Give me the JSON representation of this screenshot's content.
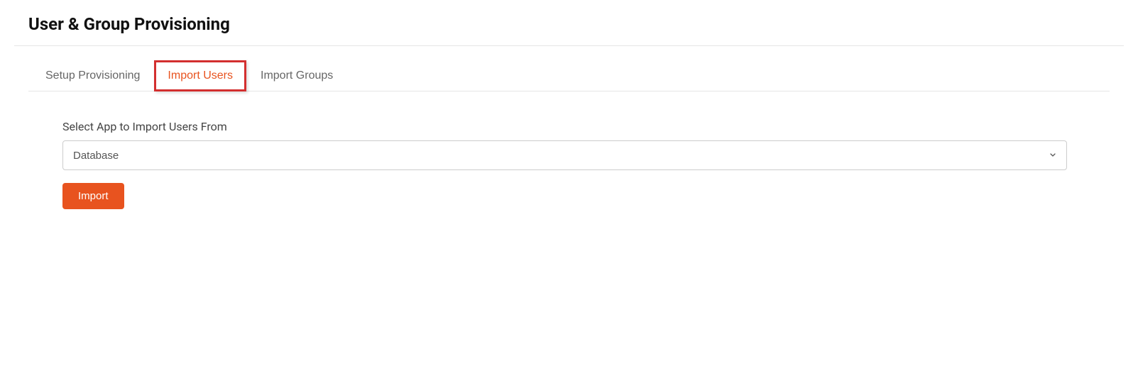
{
  "header": {
    "title": "User & Group Provisioning"
  },
  "tabs": [
    {
      "label": "Setup Provisioning",
      "active": false,
      "highlighted": false
    },
    {
      "label": "Import Users",
      "active": true,
      "highlighted": true
    },
    {
      "label": "Import Groups",
      "active": false,
      "highlighted": false
    }
  ],
  "form": {
    "select_app_label": "Select App to Import Users From",
    "selected_app": "Database",
    "import_button_label": "Import"
  }
}
